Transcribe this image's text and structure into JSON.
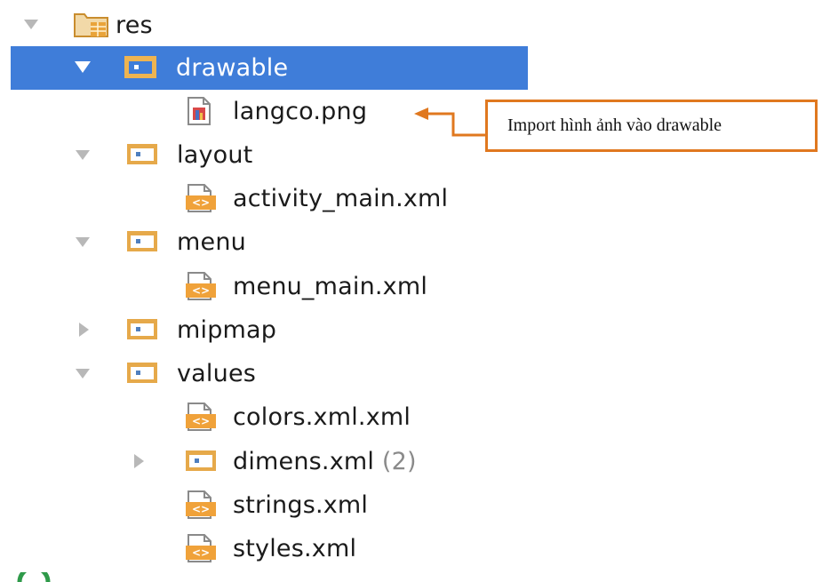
{
  "tree": {
    "items": [
      {
        "label": "res",
        "count": "",
        "expanded": true,
        "icon": "resource-folder-icon"
      },
      {
        "label": "drawable",
        "count": "",
        "expanded": true,
        "selected": true,
        "icon": "folder-icon"
      },
      {
        "label": "langco.png",
        "count": "",
        "icon": "image-file-icon"
      },
      {
        "label": "layout",
        "count": "",
        "expanded": true,
        "icon": "folder-icon"
      },
      {
        "label": "activity_main.xml",
        "count": "",
        "icon": "xml-file-icon"
      },
      {
        "label": "menu",
        "count": "",
        "expanded": true,
        "icon": "folder-icon"
      },
      {
        "label": "menu_main.xml",
        "count": "",
        "icon": "xml-file-icon"
      },
      {
        "label": "mipmap",
        "count": "",
        "expanded": false,
        "icon": "folder-icon"
      },
      {
        "label": "values",
        "count": "",
        "expanded": true,
        "icon": "folder-icon"
      },
      {
        "label": "colors.xml.xml",
        "count": "",
        "icon": "xml-file-icon"
      },
      {
        "label": "dimens.xml",
        "count": "(2)",
        "expanded": false,
        "icon": "folder-icon"
      },
      {
        "label": "strings.xml",
        "count": "",
        "icon": "xml-file-icon"
      },
      {
        "label": "styles.xml",
        "count": "",
        "icon": "xml-file-icon"
      }
    ]
  },
  "annotation": {
    "text": "Import hình ảnh vào drawable"
  },
  "colors": {
    "selection": "#3f7dd9",
    "callout_border": "#e0781f",
    "folder": "#e6a94a",
    "xml_badge": "#f0a23a"
  }
}
